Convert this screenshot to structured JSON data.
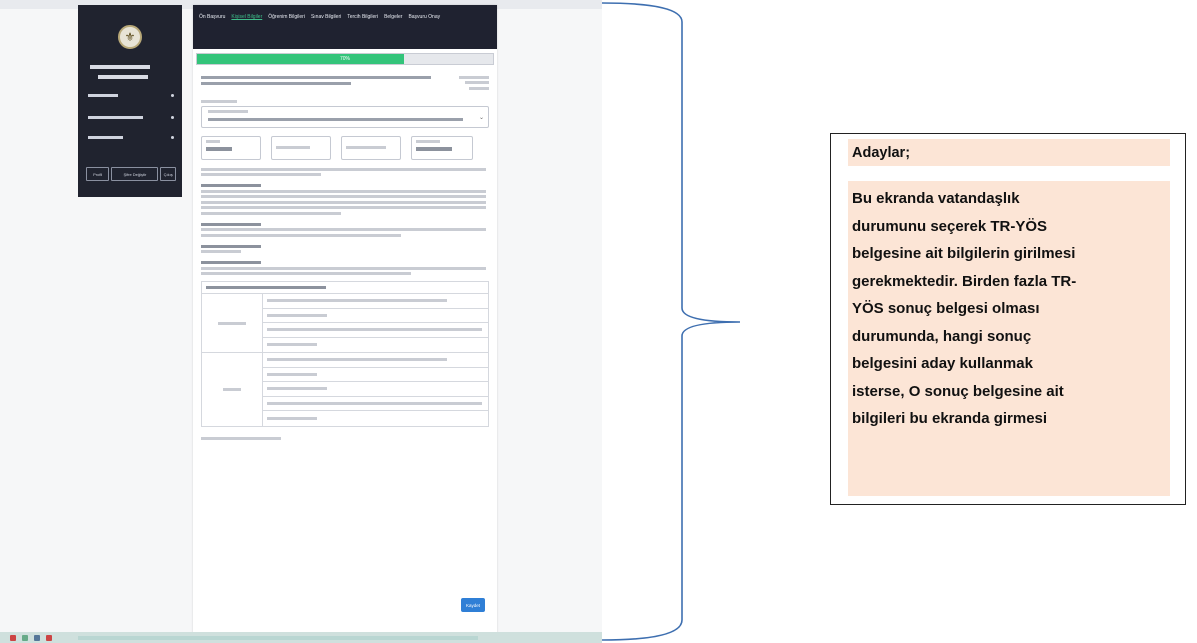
{
  "screenshot": {
    "nav": {
      "items": [
        "Ön Başvuru",
        "Kişisel Bilgiler",
        "Öğrenim Bilgileri",
        "Sınav Bilgileri",
        "Tercih Bilgileri",
        "Belgeler",
        "Başvuru Onay"
      ]
    },
    "progress": {
      "label": "70%",
      "fraction": 0.7
    },
    "sidebar": {
      "buttons": [
        "Profil",
        "Şifre Değiştir",
        "Çıkış"
      ]
    },
    "form": {
      "save_label": "Kaydet"
    }
  },
  "callout": {
    "title": "Adaylar;",
    "body_lines": [
      "Bu ekranda vatandaşlık",
      "durumunu seçerek TR-YÖS",
      "belgesine ait bilgilerin girilmesi",
      "gerekmektedir. Birden fazla TR-",
      "YÖS sonuç belgesi olması",
      "durumunda, hangi sonuç",
      "belgesini aday kullanmak",
      "isterse, O sonuç belgesine ait",
      "bilgileri bu ekranda girmesi"
    ]
  },
  "colors": {
    "callout_fill": "#fce5d6",
    "brace": "#3e6fb0",
    "progress": "#33c47a",
    "nav_bg": "#1f2230",
    "button": "#2f7fd6"
  }
}
